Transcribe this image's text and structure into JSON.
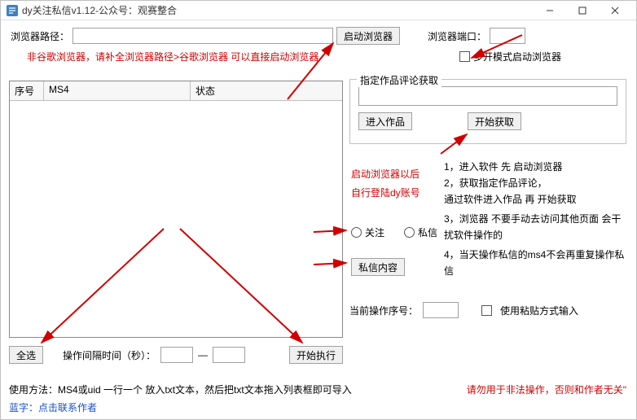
{
  "window": {
    "title": "dy关注私信v1.12-公众号：观赛整合"
  },
  "toolbar": {
    "browser_path_label": "浏览器路径：",
    "start_browser": "启动浏览器",
    "browser_port_label": "浏览器端口：",
    "multi_open_label": "多开模式启动浏览器",
    "note_nonchrome": "非谷歌浏览器，请补全浏览器路径>谷歌浏览器 可以直接启动浏览器"
  },
  "table": {
    "col1": "序号",
    "col2": "MS4",
    "col3": "状态"
  },
  "right": {
    "group_title": "指定作品评论获取",
    "enter_work": "进入作品",
    "start_fetch": "开始获取",
    "annot1": "启动浏览器以后",
    "annot2": "自行登陆dy账号",
    "radio_follow": "关注",
    "radio_dm": "私信",
    "dm_content_btn": "私信内容",
    "cur_index_label": "当前操作序号：",
    "paste_mode_label": "使用粘贴方式输入",
    "instructions": [
      "1，进入软件 先 启动浏览器",
      "2，获取指定作品评论，",
      "通过软件进入作品 再 开始获取",
      "3，浏览器 不要手动去访问其他页面 会干扰软件操作的",
      "4，当天操作私信的ms4不会再重复操作私信"
    ]
  },
  "bottom": {
    "select_all": "全选",
    "interval_label": "操作间隔时间（秒）：",
    "dash": "—",
    "start_exec": "开始执行",
    "usage": "使用方法：MS4或uid 一行一个 放入txt文本，然后把txt文本拖入列表框即可导入",
    "warn": "请勿用于非法操作，否则和作者无关\"",
    "contact": "蓝字：点击联系作者"
  }
}
